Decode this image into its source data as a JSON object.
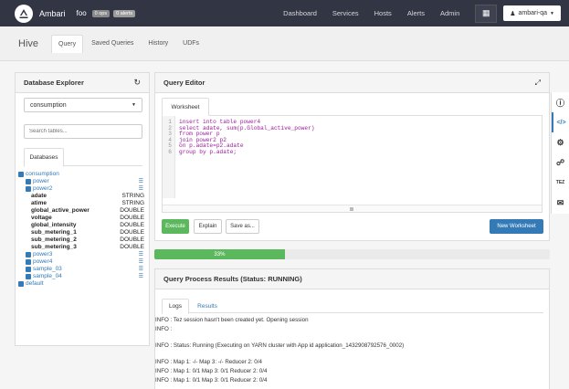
{
  "topbar": {
    "brand": "Ambari",
    "cluster": "foo",
    "ops_badge": "0 ops",
    "alerts_badge": "0 alerts",
    "nav": [
      "Dashboard",
      "Services",
      "Hosts",
      "Alerts",
      "Admin"
    ],
    "user": "ambari-qa"
  },
  "subnav": {
    "view": "Hive",
    "tabs": [
      "Query",
      "Saved Queries",
      "History",
      "UDFs"
    ],
    "active": "Query"
  },
  "db_explorer": {
    "title": "Database Explorer",
    "selected_db": "consumption",
    "search_placeholder": "Search tables...",
    "tab": "Databases",
    "databases": [
      {
        "name": "consumption",
        "tables": [
          {
            "name": "power",
            "columns": []
          },
          {
            "name": "power2",
            "columns": [
              {
                "name": "adate",
                "type": "STRING"
              },
              {
                "name": "atime",
                "type": "STRING"
              },
              {
                "name": "global_active_power",
                "type": "DOUBLE"
              },
              {
                "name": "voltage",
                "type": "DOUBLE"
              },
              {
                "name": "global_intensity",
                "type": "DOUBLE"
              },
              {
                "name": "sub_metering_1",
                "type": "DOUBLE"
              },
              {
                "name": "sub_metering_2",
                "type": "DOUBLE"
              },
              {
                "name": "sub_metering_3",
                "type": "DOUBLE"
              }
            ]
          },
          {
            "name": "power3",
            "columns": []
          },
          {
            "name": "power4",
            "columns": []
          },
          {
            "name": "sample_03",
            "columns": []
          },
          {
            "name": "sample_04",
            "columns": []
          }
        ]
      },
      {
        "name": "default",
        "tables": []
      }
    ]
  },
  "editor": {
    "title": "Query Editor",
    "tab": "Worksheet",
    "lines": [
      "insert into table power4",
      "select adate, sum(p.Global_active_power)",
      "from power p",
      "join power2 p2",
      "on p.adate=p2.adate",
      "group by p.adate;"
    ],
    "buttons": {
      "execute": "Execute",
      "explain": "Explain",
      "save_as": "Save as...",
      "new_worksheet": "New Worksheet"
    }
  },
  "progress": {
    "value": 33,
    "label": "33%"
  },
  "results": {
    "title": "Query Process Results (Status: RUNNING)",
    "tabs": [
      "Logs",
      "Results"
    ],
    "log_lines": [
      "INFO : Tez session hasn't been created yet. Opening session",
      "INFO :",
      "",
      "INFO : Status: Running (Executing on YARN cluster with App id application_1432908792576_0002)",
      "",
      "INFO : Map 1: -/- Map 3: -/- Reducer 2: 0/4",
      "INFO : Map 1: 0/1 Map 3: 0/1 Reducer 2: 0/4",
      "INFO : Map 1: 0/1 Map 3: 0/1 Reducer 2: 0/4"
    ]
  },
  "tools_sidebar": {
    "tez_label": "TEZ"
  },
  "colors": {
    "topbar": "#323544",
    "primary": "#337ab7",
    "success": "#5cb85c",
    "code": "#9b1c9b"
  }
}
